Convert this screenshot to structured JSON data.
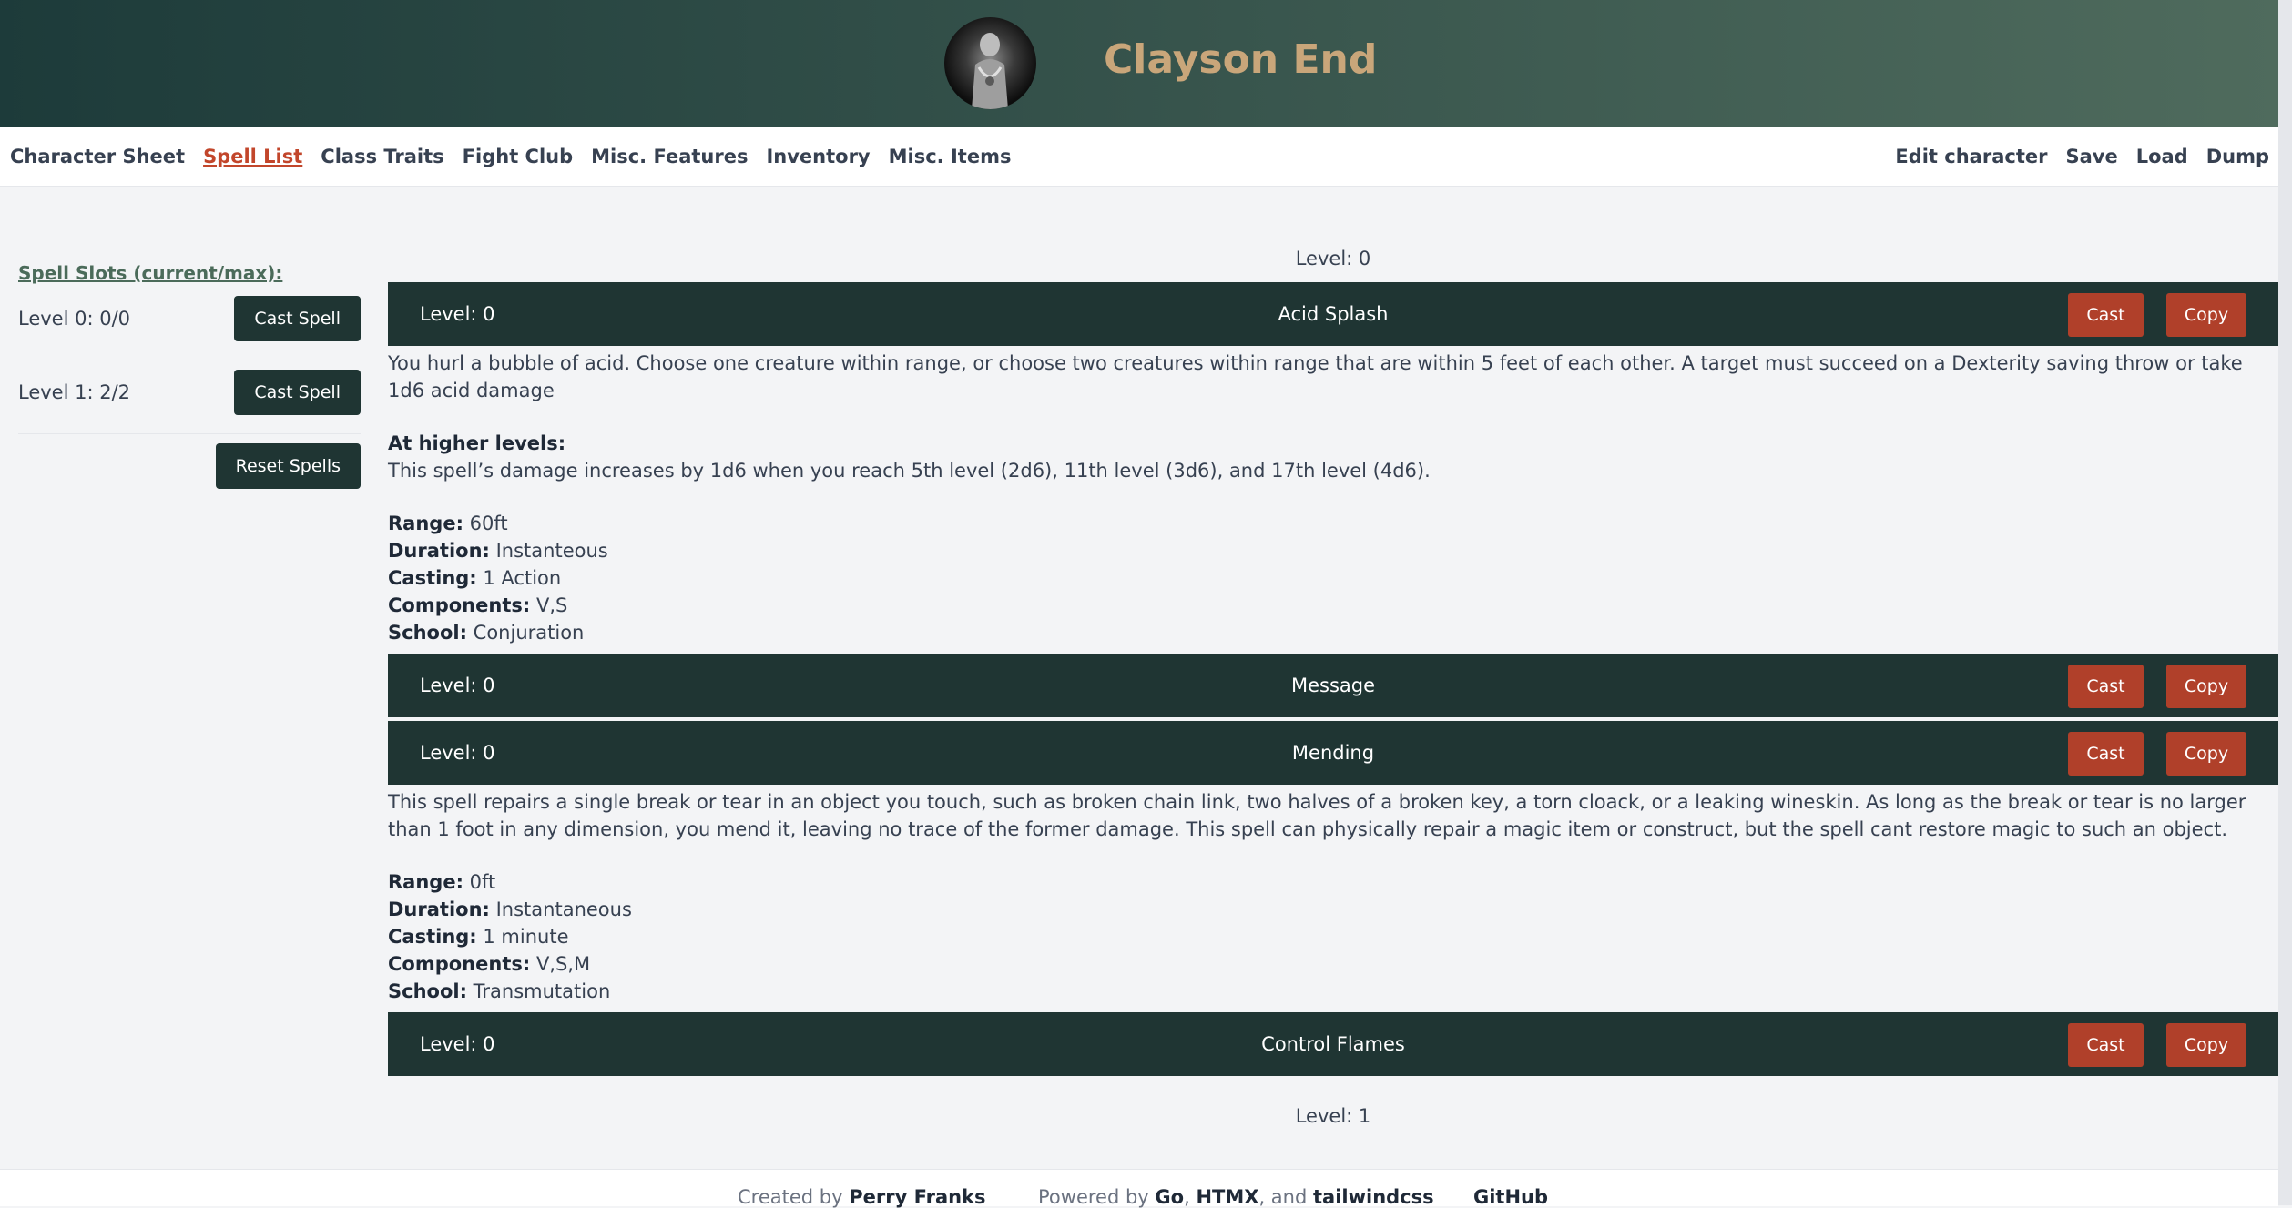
{
  "header": {
    "character_name": "Clayson End"
  },
  "nav": {
    "left": [
      "Character Sheet",
      "Spell List",
      "Class Traits",
      "Fight Club",
      "Misc. Features",
      "Inventory",
      "Misc. Items"
    ],
    "active": "Spell List",
    "right": [
      "Edit character",
      "Save",
      "Load",
      "Dump"
    ]
  },
  "sidebar": {
    "heading": "Spell Slots (current/max):",
    "slots": [
      {
        "label": "Level 0: 0/0",
        "button": "Cast Spell"
      },
      {
        "label": "Level 1: 2/2",
        "button": "Cast Spell"
      }
    ],
    "reset_button": "Reset Spells"
  },
  "main": {
    "level0_heading": "Level: 0",
    "level1_heading": "Level: 1",
    "cast_label": "Cast",
    "copy_label": "Copy",
    "spells": [
      {
        "level": "Level: 0",
        "name": "Acid Splash",
        "description": "You hurl a bubble of acid. Choose one creature within range, or choose two creatures within range that are within 5 feet of each other. A target must succeed on a Dexterity saving throw or take 1d6 acid damage",
        "higher_levels_label": "At higher levels:",
        "higher_levels": "This spell’s damage increases by 1d6 when you reach 5th level (2d6), 11th level (3d6), and 17th level (4d6).",
        "range": "60ft",
        "duration": "Instanteous",
        "casting": "1 Action",
        "components": "V,S",
        "school": "Conjuration"
      },
      {
        "level": "Level: 0",
        "name": "Message"
      },
      {
        "level": "Level: 0",
        "name": "Mending",
        "description": "This spell repairs a single break or tear in an object you touch, such as broken chain link, two halves of a broken key, a torn cloack, or a leaking wineskin. As long as the break or tear is no larger than 1 foot in any dimension, you mend it, leaving no trace of the former damage. This spell can physically repair a magic item or construct, but the spell cant restore magic to such an object.",
        "range": "0ft",
        "duration": "Instantaneous",
        "casting": "1 minute",
        "components": "V,S,M",
        "school": "Transmutation"
      },
      {
        "level": "Level: 0",
        "name": "Control Flames"
      }
    ],
    "field_labels": {
      "range": "Range:",
      "duration": "Duration:",
      "casting": "Casting:",
      "components": "Components:",
      "school": "School:"
    }
  },
  "footer": {
    "created_by": "Created by",
    "author": "Perry Franks",
    "powered_by": "Powered by",
    "go": "Go",
    "comma": ",",
    "htmx": "HTMX",
    "and": ", and",
    "tailwind": "tailwindcss",
    "github": "GitHub"
  }
}
